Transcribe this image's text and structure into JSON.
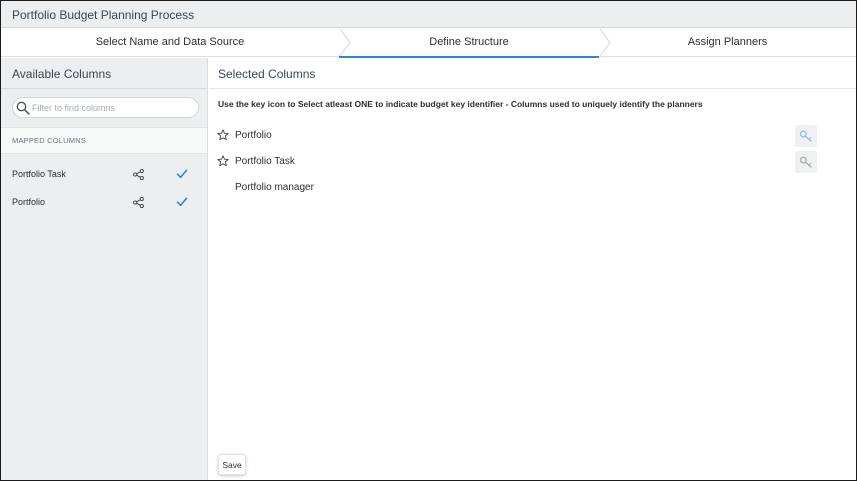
{
  "app": {
    "title": "Portfolio Budget Planning Process"
  },
  "stepper": {
    "steps": [
      {
        "label": "Select Name and Data Source",
        "active": false
      },
      {
        "label": "Define Structure",
        "active": true
      },
      {
        "label": "Assign Planners",
        "active": false
      }
    ],
    "active_color": "#2b87d8"
  },
  "available": {
    "title": "Available Columns",
    "search": {
      "placeholder": "Filter to find columns",
      "value": ""
    },
    "mapped_header": "MAPPED COLUMNS",
    "items": [
      {
        "label": "Portfolio Task",
        "checked": true,
        "icon": "share-icon"
      },
      {
        "label": "Portfolio",
        "checked": true,
        "icon": "share-icon"
      }
    ]
  },
  "selected": {
    "title": "Selected Columns",
    "instruction": "Use the key icon to Select atleast ONE to indicate budget key identifier - Columns used to uniquely identify the planners",
    "rows": [
      {
        "name": "Portfolio",
        "icon": "star-icon",
        "key_icon": "key-icon",
        "key_color": "#8fc3ec"
      },
      {
        "name": "Portfolio Task",
        "icon": "star-icon",
        "key_icon": "key-icon",
        "key_color": "#a9aeb3"
      }
    ],
    "plain_rows": [
      "Portfolio manager"
    ]
  },
  "actions": {
    "save_label": "Save"
  }
}
